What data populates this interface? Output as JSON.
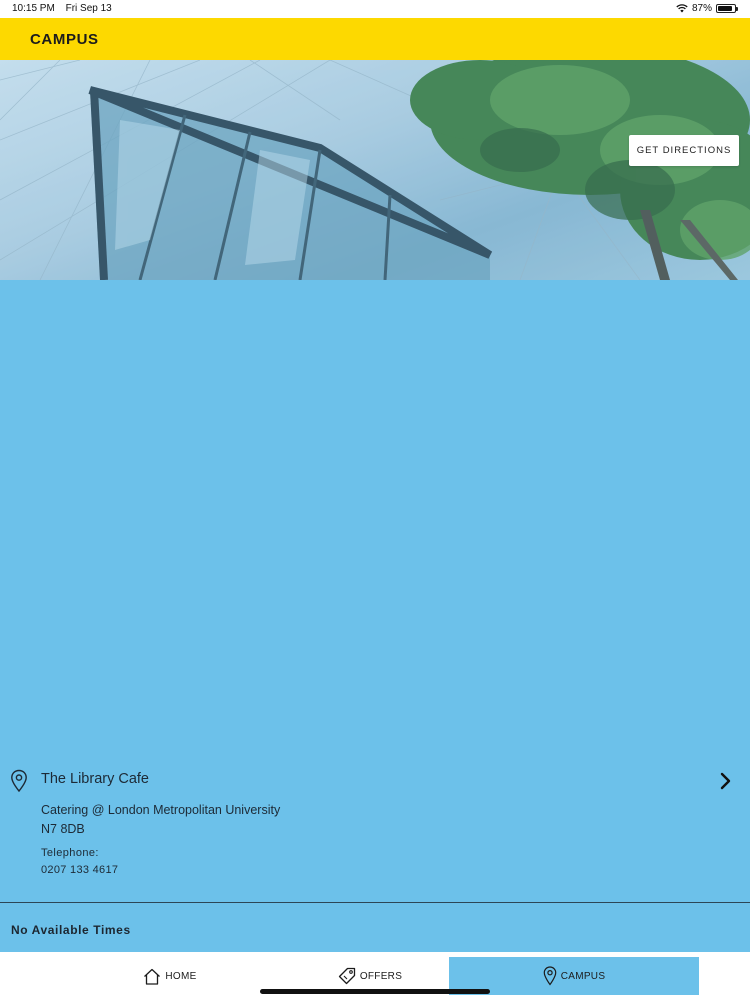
{
  "status_bar": {
    "time": "10:15 PM",
    "date": "Fri Sep 13",
    "battery": "87%",
    "battery_level": 0.87
  },
  "header": {
    "title": "CAMPUS"
  },
  "hero": {
    "directions_label": "GET DIRECTIONS"
  },
  "location": {
    "name": "The Library Cafe",
    "address_line1": "Catering @ London Metropolitan University",
    "address_line2": "N7 8DB",
    "telephone_label": "Telephone:",
    "telephone": "0207 133 4617"
  },
  "hours": {
    "message": "No Available Times"
  },
  "tabs": [
    {
      "label": "HOME",
      "icon": "home-icon"
    },
    {
      "label": "OFFERS",
      "icon": "tag-icon"
    },
    {
      "label": "CAMPUS",
      "icon": "location-pin-icon",
      "active": true
    }
  ],
  "colors": {
    "accent_yellow": "#fdd900",
    "background_blue": "#6cc1ea"
  }
}
